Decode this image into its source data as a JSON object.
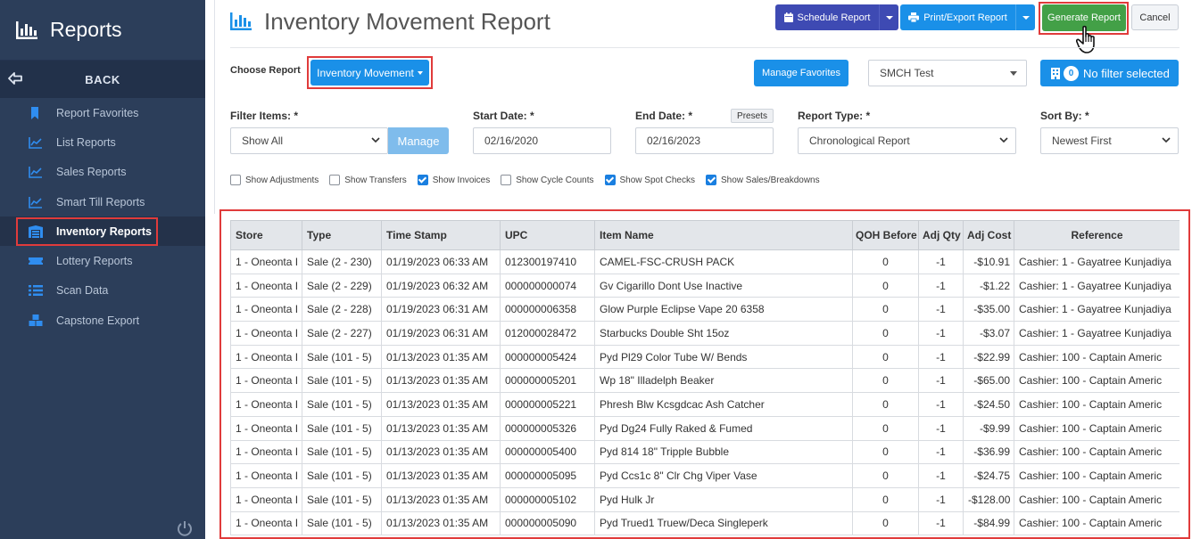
{
  "sidebar": {
    "title": "Reports",
    "back_label": "BACK",
    "items": [
      {
        "label": "Report Favorites",
        "icon": "bookmark-icon",
        "active": false
      },
      {
        "label": "List Reports",
        "icon": "chart-line-icon",
        "active": false
      },
      {
        "label": "Sales Reports",
        "icon": "chart-line-icon",
        "active": false
      },
      {
        "label": "Smart Till Reports",
        "icon": "chart-line-icon",
        "active": false
      },
      {
        "label": "Inventory Reports",
        "icon": "warehouse-icon",
        "active": true
      },
      {
        "label": "Lottery Reports",
        "icon": "ticket-icon",
        "active": false
      },
      {
        "label": "Scan Data",
        "icon": "list-icon",
        "active": false
      },
      {
        "label": "Capstone Export",
        "icon": "cubes-icon",
        "active": false
      }
    ]
  },
  "header": {
    "title": "Inventory Movement Report",
    "schedule_label": "Schedule Report",
    "print_label": "Print/Export Report",
    "generate_label": "Generate Report",
    "cancel_label": "Cancel"
  },
  "controls": {
    "choose_label": "Choose Report",
    "choose_value": "Inventory Movement",
    "favorites_label": "Manage Favorites",
    "store_value": "SMCH Test",
    "filter_count": "0",
    "filter_label": "No filter selected"
  },
  "filters": {
    "items_label": "Filter Items: *",
    "items_value": "Show All",
    "manage_label": "Manage",
    "start_label": "Start Date: *",
    "start_value": "02/16/2020",
    "end_label": "End Date: *",
    "presets_label": "Presets",
    "end_value": "02/16/2023",
    "type_label": "Report Type: *",
    "type_value": "Chronological Report",
    "sort_label": "Sort By: *",
    "sort_value": "Newest First"
  },
  "checkboxes": [
    {
      "label": "Show Adjustments",
      "checked": false
    },
    {
      "label": "Show Transfers",
      "checked": false
    },
    {
      "label": "Show Invoices",
      "checked": true
    },
    {
      "label": "Show Cycle Counts",
      "checked": false
    },
    {
      "label": "Show Spot Checks",
      "checked": true
    },
    {
      "label": "Show Sales/Breakdowns",
      "checked": true
    }
  ],
  "table": {
    "columns": [
      "Store",
      "Type",
      "Time Stamp",
      "UPC",
      "Item Name",
      "QOH Before",
      "Adj Qty",
      "Adj Cost",
      "Reference"
    ],
    "rows": [
      [
        "1 - Oneonta I",
        "Sale (2 - 230)",
        "01/19/2023 06:33 AM",
        "012300197410",
        "CAMEL-FSC-CRUSH PACK",
        "0",
        "-1",
        "-$10.91",
        "Cashier: 1 - Gayatree Kunjadiya"
      ],
      [
        "1 - Oneonta I",
        "Sale (2 - 229)",
        "01/19/2023 06:32 AM",
        "000000000074",
        "Gv Cigarillo Dont Use Inactive",
        "0",
        "-1",
        "-$1.22",
        "Cashier: 1 - Gayatree Kunjadiya"
      ],
      [
        "1 - Oneonta I",
        "Sale (2 - 228)",
        "01/19/2023 06:31 AM",
        "000000006358",
        "Glow Purple Eclipse Vape 20 6358",
        "0",
        "-1",
        "-$35.00",
        "Cashier: 1 - Gayatree Kunjadiya"
      ],
      [
        "1 - Oneonta I",
        "Sale (2 - 227)",
        "01/19/2023 06:31 AM",
        "012000028472",
        "Starbucks Double Sht 15oz",
        "0",
        "-1",
        "-$3.07",
        "Cashier: 1 - Gayatree Kunjadiya"
      ],
      [
        "1 - Oneonta I",
        "Sale (101 - 5)",
        "01/13/2023 01:35 AM",
        "000000005424",
        "Pyd Pl29 Color Tube W/ Bends",
        "0",
        "-1",
        "-$22.99",
        "Cashier: 100 - Captain Americ"
      ],
      [
        "1 - Oneonta I",
        "Sale (101 - 5)",
        "01/13/2023 01:35 AM",
        "000000005201",
        "Wp 18\" Illadelph Beaker",
        "0",
        "-1",
        "-$65.00",
        "Cashier: 100 - Captain Americ"
      ],
      [
        "1 - Oneonta I",
        "Sale (101 - 5)",
        "01/13/2023 01:35 AM",
        "000000005221",
        "Phresh Blw Kcsgdcac Ash Catcher",
        "0",
        "-1",
        "-$24.50",
        "Cashier: 100 - Captain Americ"
      ],
      [
        "1 - Oneonta I",
        "Sale (101 - 5)",
        "01/13/2023 01:35 AM",
        "000000005326",
        "Pyd Dg24 Fully Raked & Fumed",
        "0",
        "-1",
        "-$9.99",
        "Cashier: 100 - Captain Americ"
      ],
      [
        "1 - Oneonta I",
        "Sale (101 - 5)",
        "01/13/2023 01:35 AM",
        "000000005400",
        "Pyd 814 18\" Tripple Bubble",
        "0",
        "-1",
        "-$36.99",
        "Cashier: 100 - Captain Americ"
      ],
      [
        "1 - Oneonta I",
        "Sale (101 - 5)",
        "01/13/2023 01:35 AM",
        "000000005095",
        "Pyd Ccs1c 8\" Clr Chg Viper Vase",
        "0",
        "-1",
        "-$24.75",
        "Cashier: 100 - Captain Americ"
      ],
      [
        "1 - Oneonta I",
        "Sale (101 - 5)",
        "01/13/2023 01:35 AM",
        "000000005102",
        "Pyd Hulk Jr",
        "0",
        "-1",
        "-$128.00",
        "Cashier: 100 - Captain Americ"
      ],
      [
        "1 - Oneonta I",
        "Sale (101 - 5)",
        "01/13/2023 01:35 AM",
        "000000005090",
        "Pyd Trued1 Truew/Deca Singleperk",
        "0",
        "-1",
        "-$84.99",
        "Cashier: 100 - Captain Americ"
      ]
    ]
  }
}
